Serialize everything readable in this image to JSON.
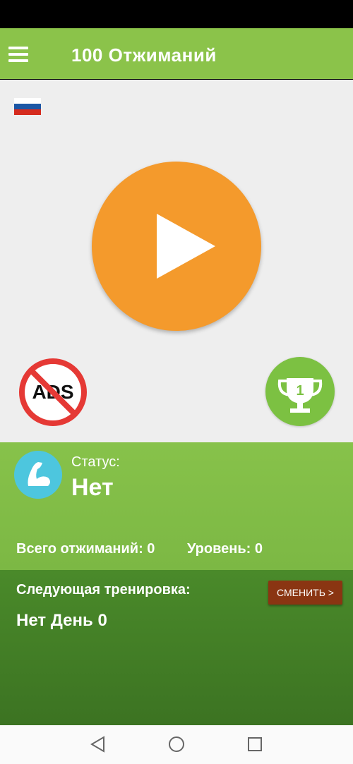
{
  "app": {
    "title": "100 Отжиманий"
  },
  "icons": {
    "menu": "hamburger-menu-icon",
    "flag": "russian-flag-icon",
    "play": "play-icon",
    "no_ads": "no-ads-icon",
    "trophy": "trophy-icon",
    "avatar": "muscle-arm-icon",
    "nav_back": "back-triangle-icon",
    "nav_home": "home-circle-icon",
    "nav_recents": "recents-square-icon"
  },
  "no_ads_badge": "ADS",
  "trophy_badge": "1",
  "status": {
    "label": "Статус:",
    "value": "Нет",
    "total_pushups": "Всего отжиманий: 0",
    "level": "Уровень: 0"
  },
  "next_workout": {
    "label": "Следующая тренировка:",
    "value": "Нет День 0",
    "change_button": "СМЕНИТЬ >"
  },
  "colors": {
    "appbar": "#8bc34a",
    "play_button": "#f49a2c",
    "trophy_button": "#7cc142",
    "status_panel": "#87c24a",
    "next_panel": "#4a8a2a",
    "change_button": "#8a3512",
    "avatar": "#4dc6de"
  }
}
